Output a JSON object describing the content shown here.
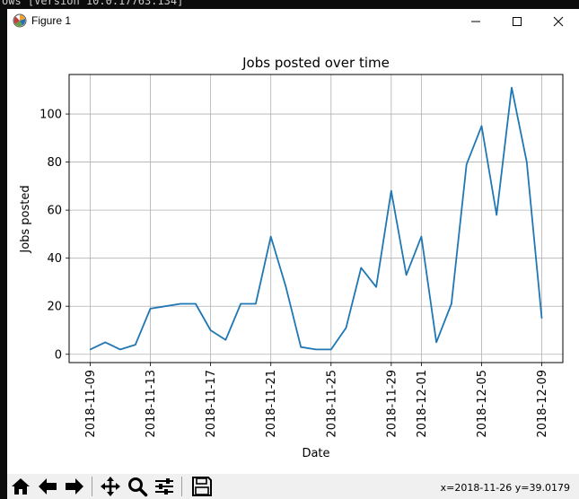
{
  "console": {
    "text": "ows [Version 10.0.17763.134]"
  },
  "window": {
    "title": "Figure 1"
  },
  "toolbar": {
    "buttons": [
      "home-icon",
      "back-icon",
      "forward-icon",
      "pan-icon",
      "zoom-icon",
      "configure-subplots-icon",
      "save-icon"
    ],
    "coord_readout": "x=2018-11-26 y=39.0179"
  },
  "colors": {
    "line": "#1f77b4",
    "grid": "#b0b0b0"
  },
  "chart_data": {
    "type": "line",
    "title": "Jobs posted over time",
    "xlabel": "Date",
    "ylabel": "Jobs posted",
    "grid": true,
    "x": [
      "2018-11-09",
      "2018-11-10",
      "2018-11-11",
      "2018-11-12",
      "2018-11-13",
      "2018-11-14",
      "2018-11-15",
      "2018-11-16",
      "2018-11-17",
      "2018-11-18",
      "2018-11-19",
      "2018-11-20",
      "2018-11-21",
      "2018-11-22",
      "2018-11-23",
      "2018-11-24",
      "2018-11-25",
      "2018-11-26",
      "2018-11-27",
      "2018-11-28",
      "2018-11-29",
      "2018-11-30",
      "2018-12-01",
      "2018-12-02",
      "2018-12-03",
      "2018-12-04",
      "2018-12-05",
      "2018-12-06",
      "2018-12-07",
      "2018-12-08",
      "2018-12-09"
    ],
    "y": [
      2,
      5,
      2,
      4,
      19,
      20,
      21,
      21,
      10,
      6,
      21,
      21,
      49,
      28,
      3,
      2,
      2,
      11,
      36,
      28,
      68,
      33,
      49,
      5,
      21,
      79,
      95,
      58,
      111,
      80,
      15
    ],
    "xticks": [
      "2018-11-09",
      "2018-11-13",
      "2018-11-17",
      "2018-11-21",
      "2018-11-25",
      "2018-11-29",
      "2018-12-01",
      "2018-12-05",
      "2018-12-09"
    ],
    "yticks": [
      0,
      20,
      40,
      60,
      80,
      100
    ],
    "xlim": [
      "2018-11-07T14:24",
      "2018-12-10T09:36"
    ],
    "ylim": [
      -3.45,
      116.45
    ]
  }
}
